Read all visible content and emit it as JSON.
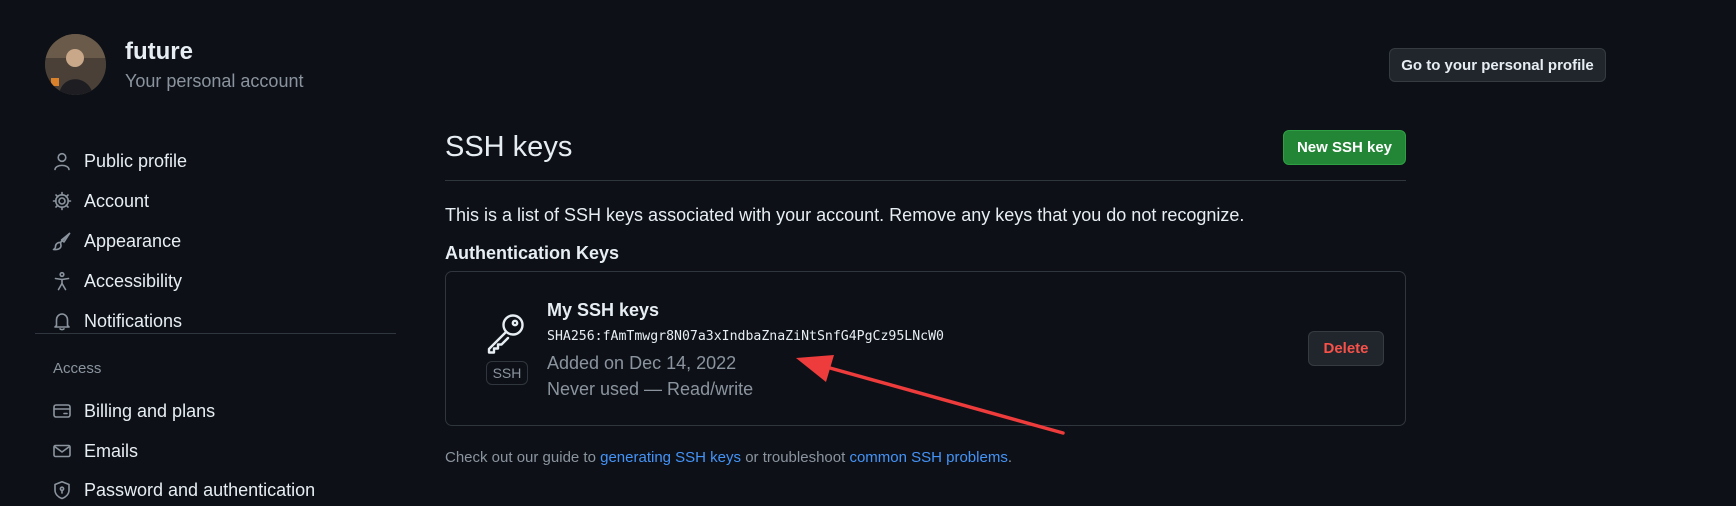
{
  "header": {
    "username": "future",
    "subtitle": "Your personal account",
    "profile_button": "Go to your personal profile"
  },
  "sidebar": {
    "items": [
      {
        "label": "Public profile",
        "icon": "person-icon"
      },
      {
        "label": "Account",
        "icon": "gear-icon"
      },
      {
        "label": "Appearance",
        "icon": "paintbrush-icon"
      },
      {
        "label": "Accessibility",
        "icon": "accessibility-icon"
      },
      {
        "label": "Notifications",
        "icon": "bell-icon"
      }
    ],
    "access_heading": "Access",
    "access_items": [
      {
        "label": "Billing and plans",
        "icon": "credit-card-icon"
      },
      {
        "label": "Emails",
        "icon": "mail-icon"
      },
      {
        "label": "Password and authentication",
        "icon": "shield-lock-icon"
      }
    ]
  },
  "main": {
    "title": "SSH keys",
    "new_key_button": "New SSH key",
    "intro": "This is a list of SSH keys associated with your account. Remove any keys that you do not recognize.",
    "auth_heading": "Authentication Keys",
    "key": {
      "badge": "SSH",
      "title": "My SSH keys",
      "fingerprint": "SHA256:fAmTmwgr8N07a3xIndbaZnaZiNtSnfG4PgCz95LNcW0",
      "added": "Added on Dec 14, 2022",
      "usage": "Never used — Read/write",
      "delete_button": "Delete"
    },
    "footer": {
      "prefix": "Check out our guide to ",
      "link1": "generating SSH keys",
      "middle": " or troubleshoot ",
      "link2": "common SSH problems",
      "suffix": "."
    }
  },
  "colors": {
    "background": "#0d1117",
    "primary_button": "#238636",
    "danger_text": "#f85149",
    "link": "#4493f8",
    "annotation_arrow": "#ee3b3b"
  }
}
